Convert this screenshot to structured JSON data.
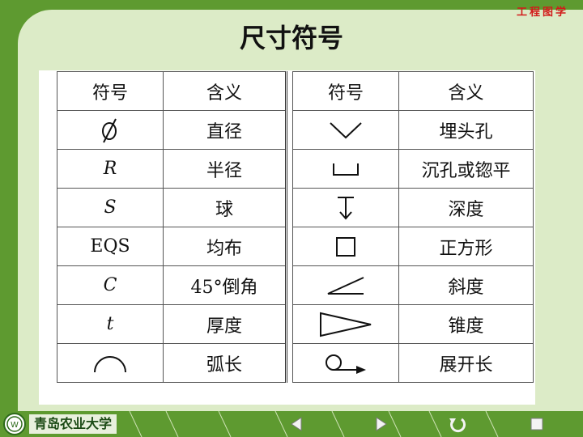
{
  "brand": "工程图学",
  "title": "尺寸符号",
  "table": {
    "headers": [
      "符号",
      "含义",
      "符号",
      "含义"
    ],
    "left_rows": [
      {
        "symbol_icon": "diameter-icon",
        "meaning": "直径"
      },
      {
        "symbol_text": "R",
        "meaning": "半径"
      },
      {
        "symbol_text": "S",
        "meaning": "球"
      },
      {
        "symbol_text": "EQS",
        "meaning": "均布"
      },
      {
        "symbol_text": "C",
        "meaning": "45°倒角"
      },
      {
        "symbol_text": "t",
        "meaning": "厚度"
      },
      {
        "symbol_icon": "arc-icon",
        "meaning": "弧长"
      }
    ],
    "right_rows": [
      {
        "symbol_icon": "countersink-icon",
        "meaning": "埋头孔"
      },
      {
        "symbol_icon": "counterbore-icon",
        "meaning": "沉孔或锪平"
      },
      {
        "symbol_icon": "depth-icon",
        "meaning": "深度"
      },
      {
        "symbol_icon": "square-icon",
        "meaning": "正方形"
      },
      {
        "symbol_icon": "slope-icon",
        "meaning": "斜度"
      },
      {
        "symbol_icon": "taper-icon",
        "meaning": "锥度"
      },
      {
        "symbol_icon": "developed-length-icon",
        "meaning": "展开长"
      }
    ]
  },
  "footer": {
    "logo_text": "青岛农业大学",
    "nav": [
      "previous-icon",
      "next-icon",
      "return-icon",
      "stop-icon"
    ]
  },
  "colors": {
    "background": "#5e9a30",
    "panel": "#dcebc7",
    "brand": "#d21a1a"
  }
}
